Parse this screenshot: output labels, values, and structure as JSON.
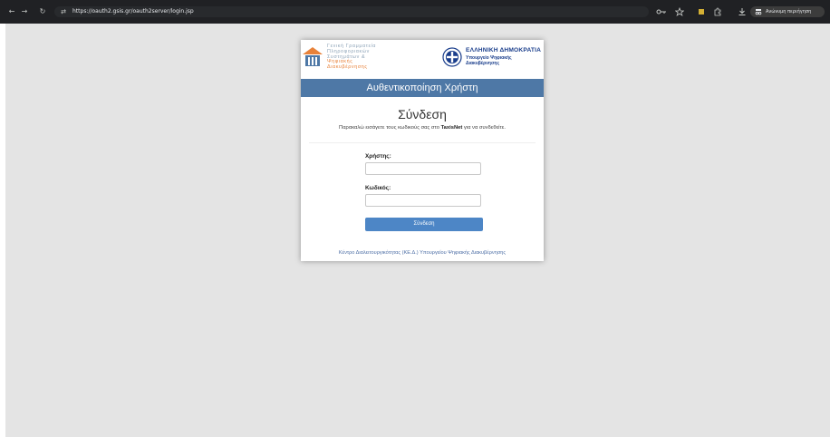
{
  "browser": {
    "back_icon": "←",
    "forward_icon": "→",
    "reload_icon": "↻",
    "site_info_icon": "⇄",
    "url": "https://oauth2.gsis.gr/oauth2server/login.jsp",
    "icons": [
      "key-icon",
      "star-icon",
      "extension-icon",
      "puzzle-icon",
      "download-icon"
    ],
    "incognito_label": "Ανώνυμη περιήγηση"
  },
  "header": {
    "gsis_logo_lines": [
      "Γενική Γραμματεία",
      "Πληροφοριακών",
      "Συστημάτων &",
      "Ψηφιακής Διακυβέρνησης"
    ],
    "gov_title": "ΕΛΛΗΝΙΚΗ ΔΗΜΟΚΡΑΤΙΑ",
    "gov_ministry_line1": "Υπουργείο Ψηφιακής",
    "gov_ministry_line2": "Διακυβέρνησης"
  },
  "banner": {
    "title": "Αυθεντικοποίηση Χρήστη"
  },
  "form": {
    "heading": "Σύνδεση",
    "instruction_before": "Παρακαλώ εισάγετε τους κωδικούς σας στο ",
    "instruction_bold": "TaxisNet",
    "instruction_after": " για να συνδεθείτε.",
    "username_label": "Χρήστης:",
    "username_value": "",
    "password_label": "Κωδικός:",
    "password_value": "",
    "submit_label": "Σύνδεση"
  },
  "footer": {
    "link_text": "Κέντρο Διαλειτουργικότητας (ΚΕ.Δ.) Υπουργείου Ψηφιακής Διακυβέρνησης"
  },
  "colors": {
    "banner": "#4e78a6",
    "button": "#4d86c6",
    "page_background": "#e4e4e4",
    "gov_blue": "#1a3e8c",
    "gsis_orange": "#e8823a"
  }
}
